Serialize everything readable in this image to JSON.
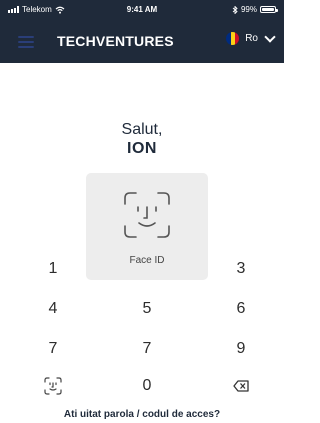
{
  "status_bar": {
    "carrier": "Telekom",
    "time": "9:41 AM",
    "battery": "99%"
  },
  "header": {
    "brand": "TECHVENTURES",
    "language": "Ro"
  },
  "greeting": {
    "line1": "Salut,",
    "name": "ION"
  },
  "face_id": {
    "label": "Face ID"
  },
  "keypad": {
    "k1": "1",
    "k3": "3",
    "k4": "4",
    "k5": "5",
    "k6": "6",
    "k7": "7",
    "k9": "9",
    "k0": "0"
  },
  "forgot_link": "Ati uitat parola / codul de acces?",
  "colors": {
    "header_bg": "#1f2a3a",
    "menu_icon": "#2a3e78",
    "flag_blue": "#002b7f",
    "flag_yellow": "#fcd116",
    "flag_red": "#ce1126"
  }
}
